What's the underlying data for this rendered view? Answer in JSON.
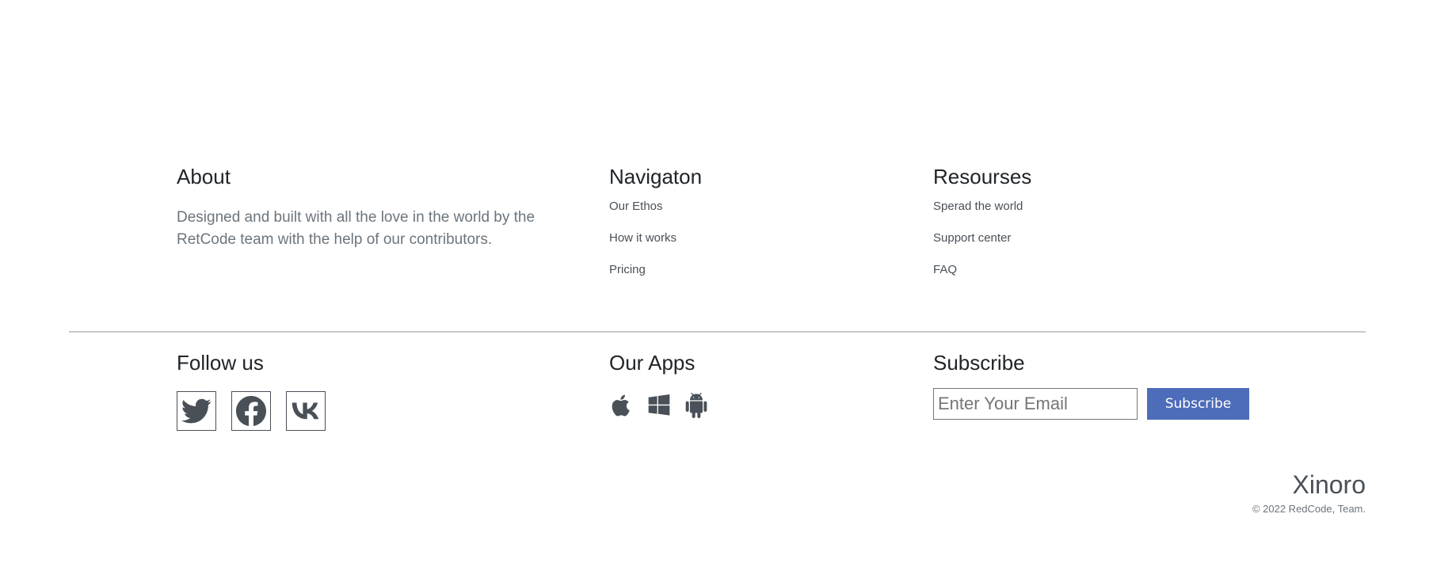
{
  "about": {
    "heading": "About",
    "text": "Designed and built with all the love in the world by the RetCode team with the help of our contributors."
  },
  "navigation": {
    "heading": "Navigaton",
    "links": [
      "Our Ethos",
      "How it works",
      "Pricing"
    ]
  },
  "resources": {
    "heading": "Resourses",
    "links": [
      "Sperad the world",
      "Support center",
      "FAQ"
    ]
  },
  "follow": {
    "heading": "Follow us",
    "icons": [
      "twitter-icon",
      "facebook-icon",
      "vk-icon"
    ]
  },
  "apps": {
    "heading": "Our Apps",
    "icons": [
      "apple-icon",
      "windows-icon",
      "android-icon"
    ]
  },
  "subscribe": {
    "heading": "Subscribe",
    "placeholder": "Enter Your Email",
    "button_label": "Subscribe",
    "button_color": "#4d6cba"
  },
  "brand": {
    "name": "Xinoro",
    "copyright": "© 2022 RedCode, Team."
  }
}
